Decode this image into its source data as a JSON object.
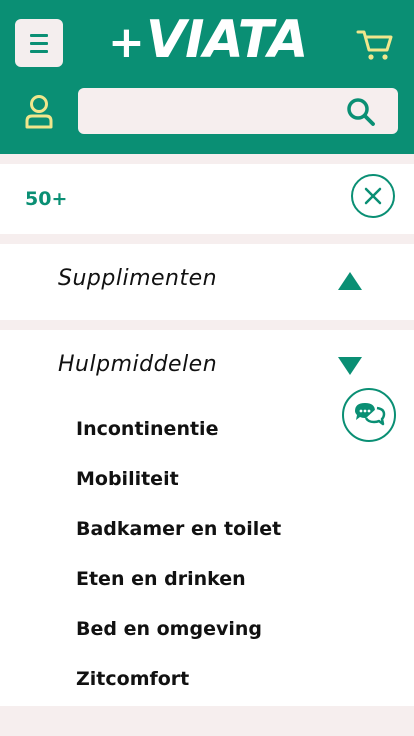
{
  "header": {
    "logo_text": "VIATA",
    "logo_plus": "+",
    "search": {
      "placeholder": ""
    }
  },
  "menu": {
    "age_filter": "50+",
    "categories": [
      {
        "title": "Supplimenten",
        "state": "collapsed"
      },
      {
        "title": "Hulpmiddelen",
        "state": "expanded",
        "items": [
          "Incontinentie",
          "Mobiliteit",
          "Badkamer en toilet",
          "Eten en drinken",
          "Bed en omgeving",
          "Zitcomfort"
        ]
      }
    ]
  },
  "colors": {
    "brand": "#0a8f74",
    "accent": "#f0e68c",
    "background": "#f6eeee"
  }
}
